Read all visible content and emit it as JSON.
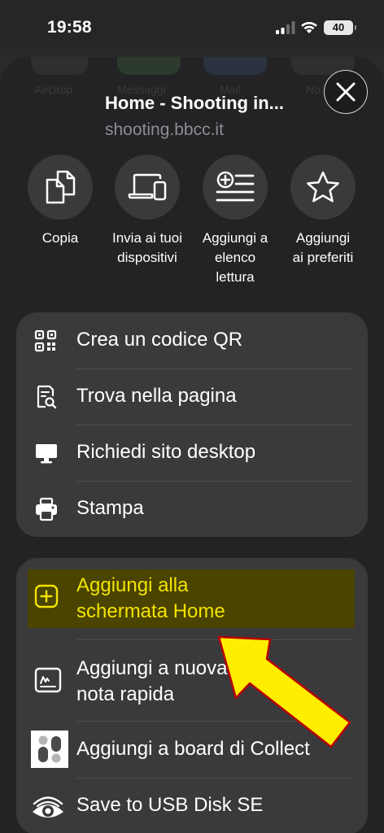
{
  "status_bar": {
    "time": "19:58",
    "battery": "40"
  },
  "sheet": {
    "background_apps": [
      "AirDrop",
      "Messaggi",
      "Mail",
      "No"
    ],
    "title": "Home - Shooting in...",
    "url": "shooting.bbcc.it",
    "actions": [
      {
        "label": "Copia",
        "icon": "copy-icon"
      },
      {
        "label": "Invia ai tuoi\ndispositivi",
        "icon": "devices-icon"
      },
      {
        "label": "Aggiungi a\nelenco\nlettura",
        "icon": "reading-list-icon"
      },
      {
        "label": "Aggiungi\nai preferiti",
        "icon": "star-icon"
      }
    ],
    "group1": [
      {
        "label": "Crea un codice QR",
        "icon": "qr-code-icon"
      },
      {
        "label": "Trova nella pagina",
        "icon": "find-in-page-icon"
      },
      {
        "label": "Richiedi sito desktop",
        "icon": "desktop-icon"
      },
      {
        "label": "Stampa",
        "icon": "printer-icon"
      }
    ],
    "group2": [
      {
        "label": "Aggiungi alla\nschermata Home",
        "icon": "add-square-icon",
        "highlighted": true
      },
      {
        "label": "Aggiungi a nuova\nnota rapida",
        "icon": "quick-note-icon"
      },
      {
        "label": "Aggiungi a board di Collect",
        "icon": "collect-app-icon"
      },
      {
        "label": "Save to USB Disk SE",
        "icon": "usb-eye-icon"
      }
    ]
  },
  "colors": {
    "highlight_bg": "#4a4400",
    "highlight_text": "#f2e300",
    "arrow_fill": "#ffee00",
    "arrow_stroke": "#b80000"
  }
}
